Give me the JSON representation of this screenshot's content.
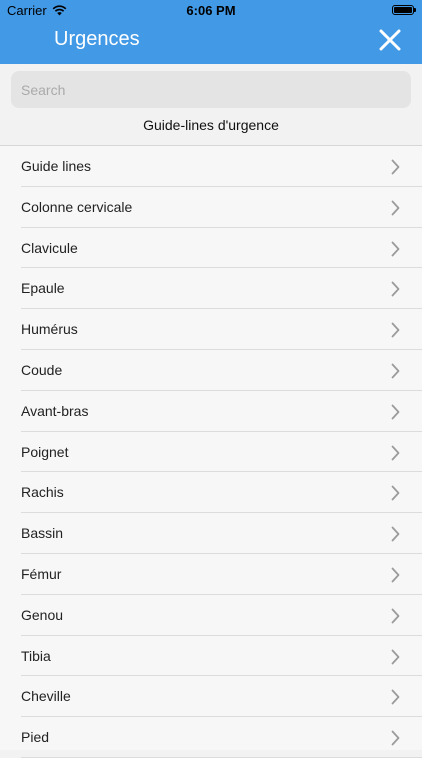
{
  "status_bar": {
    "carrier": "Carrier",
    "time": "6:06 PM",
    "icons": [
      "wifi-icon",
      "battery-icon"
    ]
  },
  "header": {
    "title": "Urgences",
    "close_icon": "close-icon",
    "background": "#4299e6"
  },
  "search": {
    "placeholder": "Search",
    "value": ""
  },
  "section": {
    "title": "Guide-lines d'urgence"
  },
  "list": {
    "items": [
      {
        "label": "Guide lines"
      },
      {
        "label": "Colonne cervicale"
      },
      {
        "label": "Clavicule"
      },
      {
        "label": "Epaule"
      },
      {
        "label": "Humérus"
      },
      {
        "label": "Coude"
      },
      {
        "label": "Avant-bras"
      },
      {
        "label": "Poignet"
      },
      {
        "label": "Rachis"
      },
      {
        "label": "Bassin"
      },
      {
        "label": "Fémur"
      },
      {
        "label": "Genou"
      },
      {
        "label": "Tibia"
      },
      {
        "label": "Cheville"
      },
      {
        "label": "Pied"
      }
    ],
    "chevron_icon": "chevron-right-icon"
  }
}
